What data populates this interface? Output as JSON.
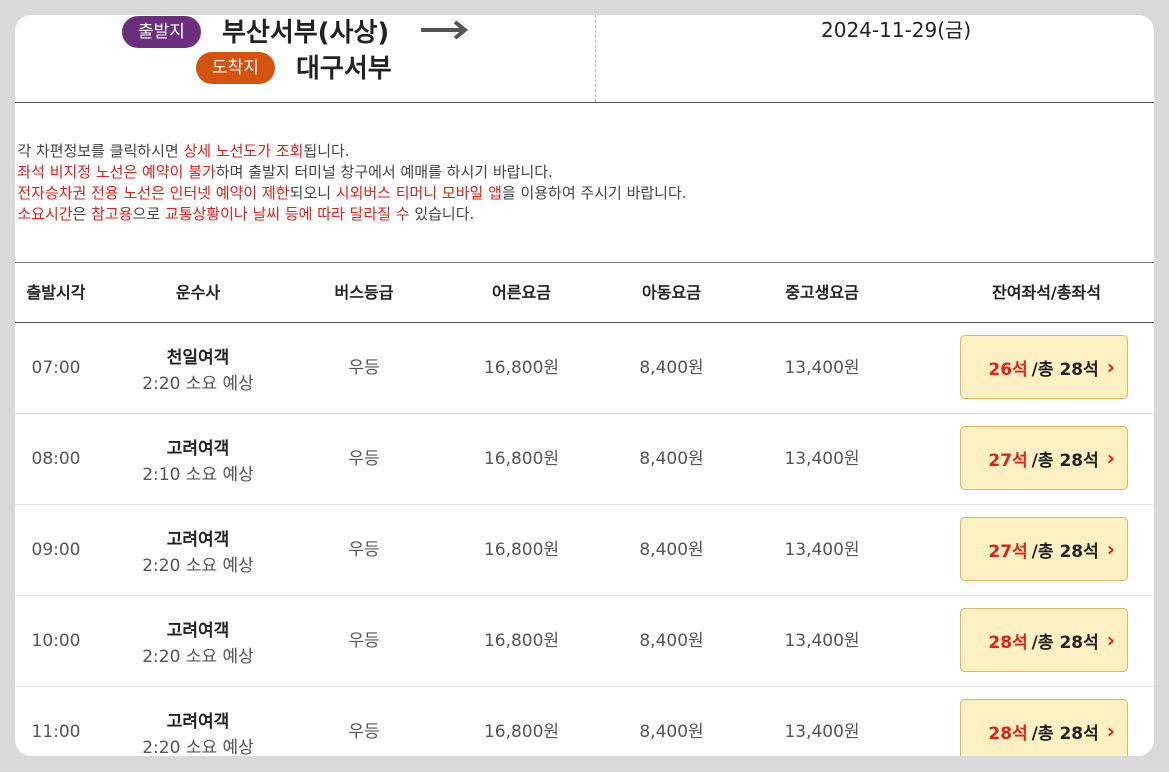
{
  "route": {
    "departure_badge": "출발지",
    "departure_terminal": "부산서부(사상)",
    "arrival_badge": "도착지",
    "arrival_terminal": "대구서부",
    "date": "2024-11-29(금)",
    "colors": {
      "departure_badge": "#6b2f7e",
      "arrival_badge": "#d4530e"
    }
  },
  "notices": [
    [
      {
        "t": "※ 각 차편정보를 클릭하시면 ",
        "red": false
      },
      {
        "t": "상세 노선도가 조회",
        "red": true
      },
      {
        "t": "됩니다.",
        "red": false
      }
    ],
    [
      {
        "t": "※ ",
        "red": false
      },
      {
        "t": "좌석 비지정 노선은 예약이 불가",
        "red": true
      },
      {
        "t": "하며 출발지 터미널 창구에서 예매를 하시기 바랍니다.",
        "red": false
      }
    ],
    [
      {
        "t": "※ ",
        "red": false
      },
      {
        "t": "전자승차권 전용 노선은 인터넷 예약이 제한",
        "red": true
      },
      {
        "t": "되오니 ",
        "red": false
      },
      {
        "t": "시외버스 티머니 모바일 앱",
        "red": true
      },
      {
        "t": "을 이용하여 주시기 바랍니다.",
        "red": false
      }
    ],
    [
      {
        "t": "※ ",
        "red": false
      },
      {
        "t": "소요시간",
        "red": true
      },
      {
        "t": "은 ",
        "red": false
      },
      {
        "t": "참고용",
        "red": true
      },
      {
        "t": "으로 ",
        "red": false
      },
      {
        "t": "교통상황이나 날씨 등에 따라 달라질 수",
        "red": true
      },
      {
        "t": " 있습니다.",
        "red": false
      }
    ]
  ],
  "table": {
    "headers": [
      "출발시각",
      "운수사",
      "버스등급",
      "어른요금",
      "아동요금",
      "중고생요금",
      "잔여좌석/총좌석"
    ],
    "rows": [
      {
        "time": "07:00",
        "operator": "천일여객",
        "duration": "2:20 소요 예상",
        "grade": "우등",
        "adult": "16,800원",
        "child": "8,400원",
        "teen": "13,400원",
        "remain": "26석",
        "total": "/총 28석"
      },
      {
        "time": "08:00",
        "operator": "고려여객",
        "duration": "2:10 소요 예상",
        "grade": "우등",
        "adult": "16,800원",
        "child": "8,400원",
        "teen": "13,400원",
        "remain": "27석",
        "total": "/총 28석"
      },
      {
        "time": "09:00",
        "operator": "고려여객",
        "duration": "2:20 소요 예상",
        "grade": "우등",
        "adult": "16,800원",
        "child": "8,400원",
        "teen": "13,400원",
        "remain": "27석",
        "total": "/총 28석"
      },
      {
        "time": "10:00",
        "operator": "고려여객",
        "duration": "2:20 소요 예상",
        "grade": "우등",
        "adult": "16,800원",
        "child": "8,400원",
        "teen": "13,400원",
        "remain": "28석",
        "total": "/총 28석"
      },
      {
        "time": "11:00",
        "operator": "고려여객",
        "duration": "2:20 소요 예상",
        "grade": "우등",
        "adult": "16,800원",
        "child": "8,400원",
        "teen": "13,400원",
        "remain": "28석",
        "total": "/총 28석"
      }
    ]
  },
  "icons": {
    "route_arrow": "arrow-right-icon",
    "seat_chevron": "chevron-right-icon"
  },
  "colors": {
    "highlight_red": "#e0201a",
    "seat_button_bg": "#fdf0c2",
    "seat_button_border": "#e5b35a"
  }
}
